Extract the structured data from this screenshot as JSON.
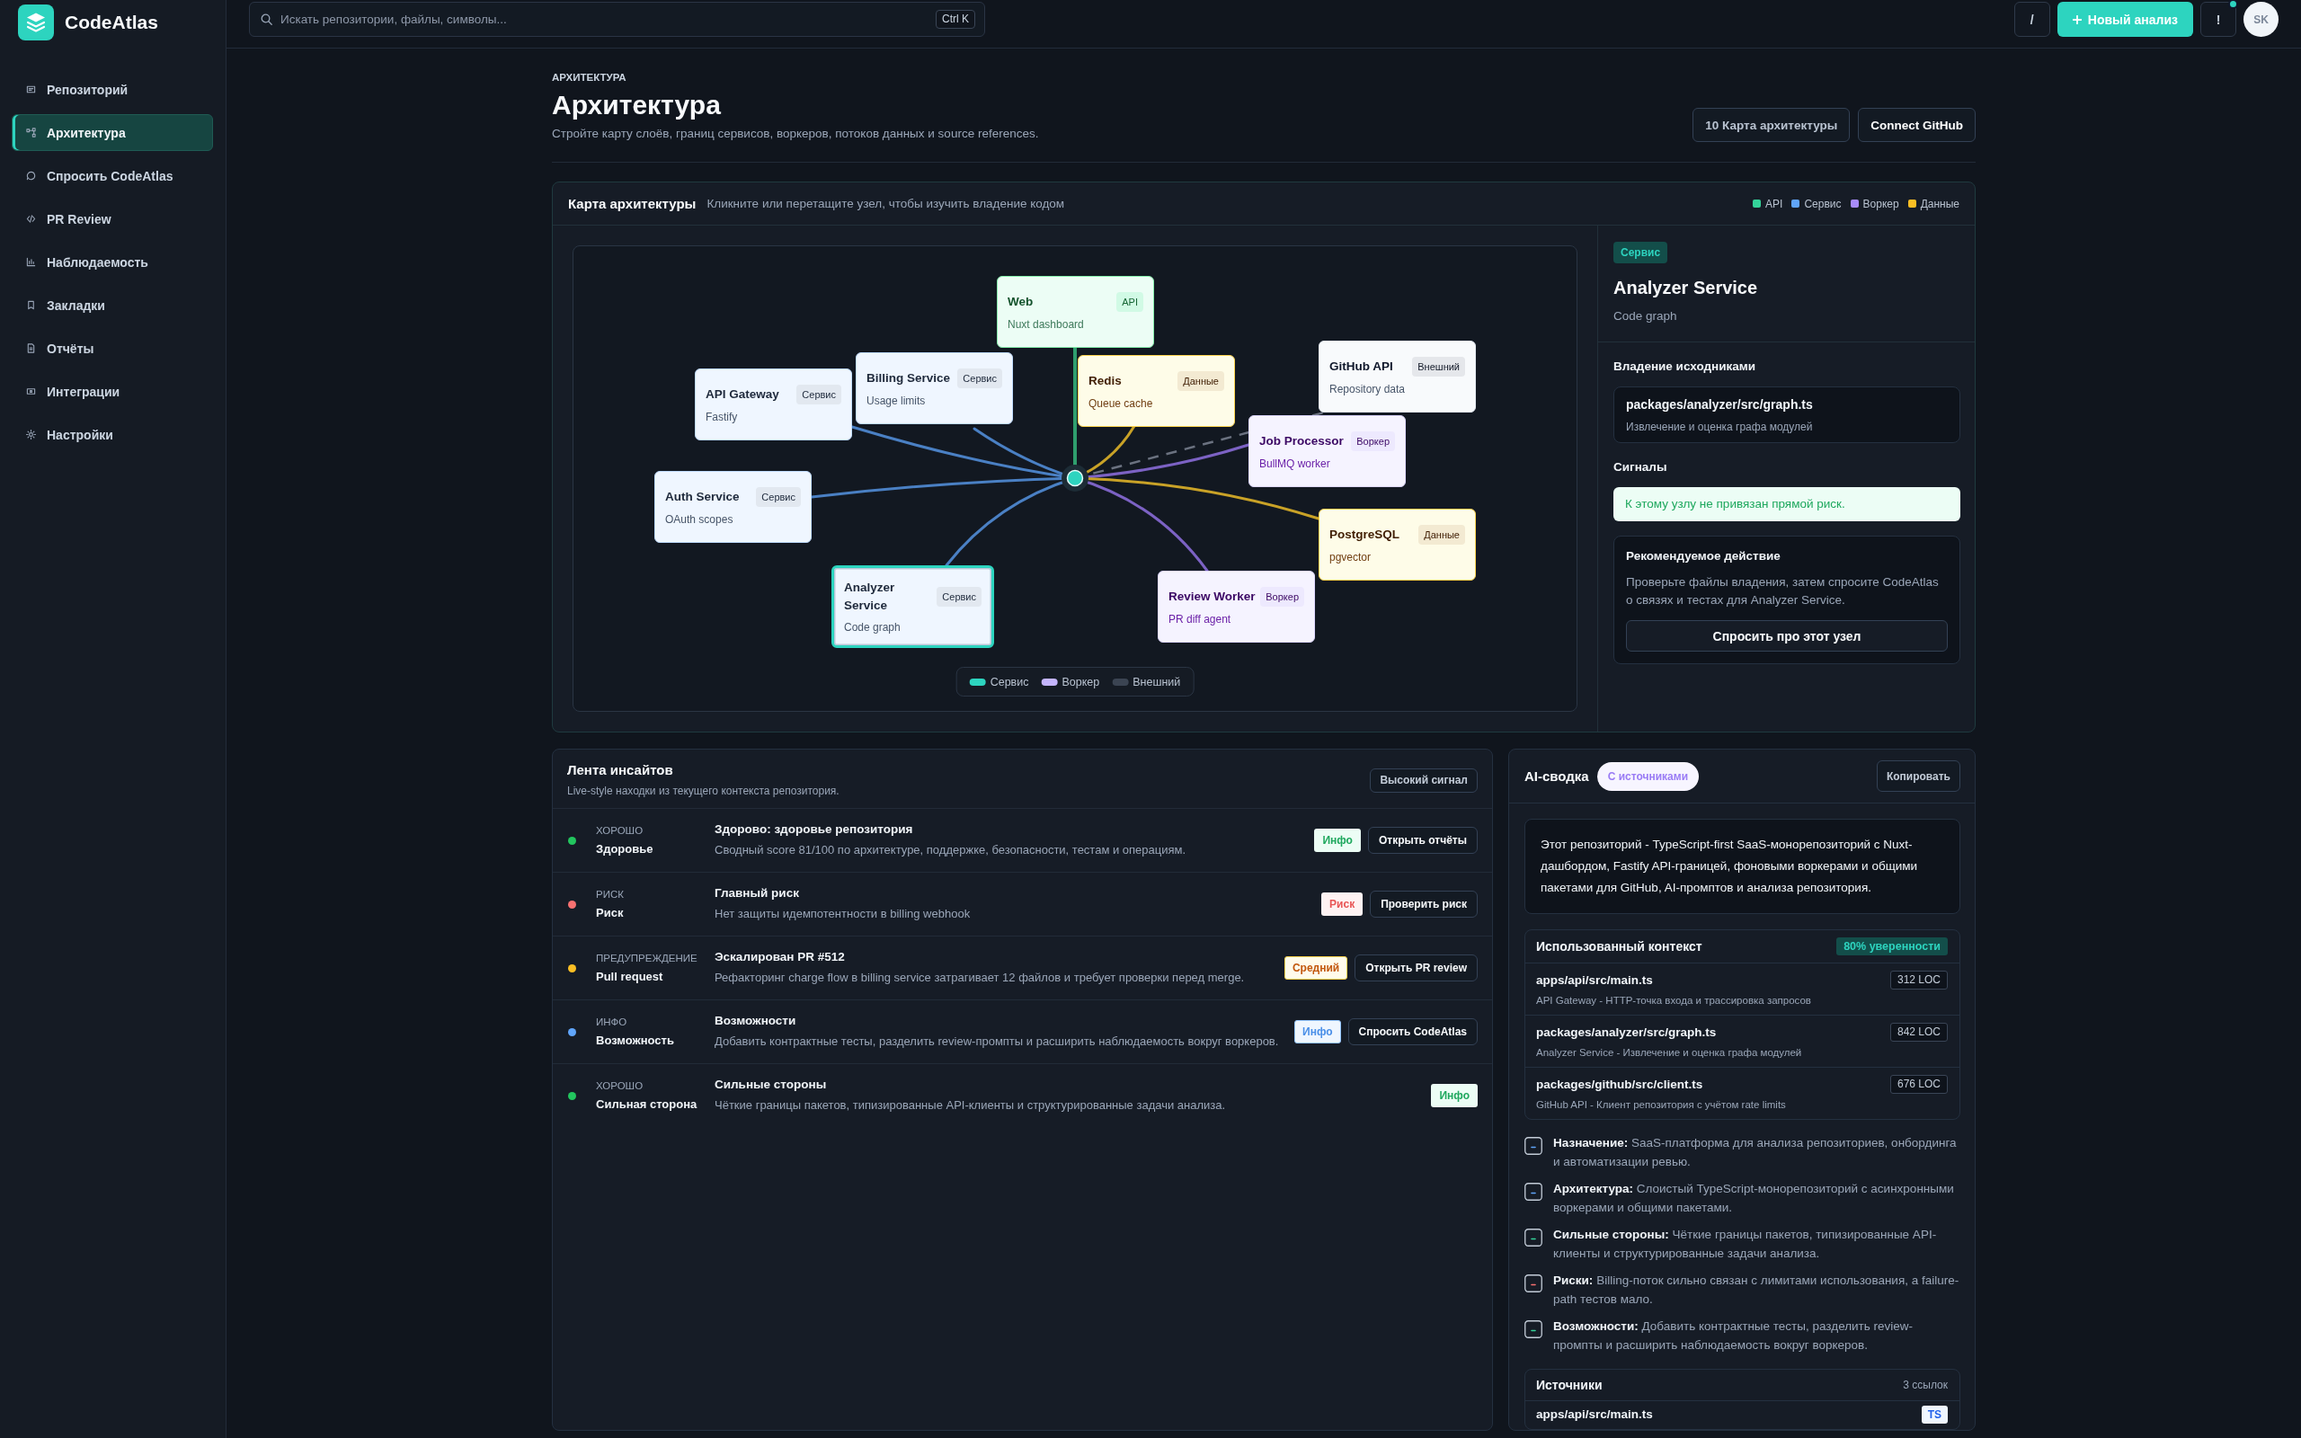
{
  "sidebar": {
    "brand": "CodeAtlas",
    "items": [
      {
        "label": "Репозиторий",
        "selected": false
      },
      {
        "label": "Архитектура",
        "selected": true
      },
      {
        "label": "Спросить CodeAtlas",
        "selected": false
      },
      {
        "label": "PR Review",
        "selected": false
      },
      {
        "label": "Наблюдаемость",
        "selected": false
      },
      {
        "label": "Закладки",
        "selected": false
      },
      {
        "label": "Отчёты",
        "selected": false
      },
      {
        "label": "Интеграции",
        "selected": false
      },
      {
        "label": "Настройки",
        "selected": false
      }
    ]
  },
  "topbar": {
    "search": {
      "placeholder": "Искать репозитории, файлы, символы...",
      "shortcut": "Ctrl K"
    },
    "actions": [
      {
        "kind": "icon",
        "label": "/",
        "notification": false
      },
      {
        "kind": "primary",
        "label": "Новый анализ",
        "notification": false
      },
      {
        "kind": "icon",
        "label": "!",
        "notification": true
      }
    ],
    "avatar": {
      "initials": "SK"
    }
  },
  "page_header": {
    "eyebrow": "АРХИТЕКТУРА",
    "title": "Архитектура",
    "subtitle": "Стройте карту слоёв, границ сервисов, воркеров, потоков данных и source references.",
    "actions": [
      {
        "kind": "secondary",
        "label": "10 Карта архитектуры"
      },
      {
        "kind": "outline",
        "label": "Connect GitHub"
      }
    ]
  },
  "architecture_map": {
    "title": "Карта архитектуры",
    "hint": "Кликните или перетащите узел, чтобы изучить владение кодом",
    "legend": [
      {
        "label": "API",
        "color": "#34d399"
      },
      {
        "label": "Сервис",
        "color": "#60a5fa"
      },
      {
        "label": "Воркер",
        "color": "#a78bfa"
      },
      {
        "label": "Данные",
        "color": "#fbbf24"
      }
    ],
    "nodes": [
      {
        "title": "Web",
        "subtitle": "Nuxt dashboard",
        "badge": "API",
        "kind": "api",
        "selected": false
      },
      {
        "title": "API Gateway",
        "subtitle": "Fastify",
        "badge": "Сервис",
        "kind": "service",
        "selected": false
      },
      {
        "title": "Billing Service",
        "subtitle": "Usage limits",
        "badge": "Сервис",
        "kind": "service",
        "selected": false
      },
      {
        "title": "Redis",
        "subtitle": "Queue cache",
        "badge": "Данные",
        "kind": "data",
        "selected": false
      },
      {
        "title": "GitHub API",
        "subtitle": "Repository data",
        "badge": "Внешний",
        "kind": "external",
        "selected": false
      },
      {
        "title": "Job Processor",
        "subtitle": "BullMQ worker",
        "badge": "Воркер",
        "kind": "worker",
        "selected": false
      },
      {
        "title": "Auth Service",
        "subtitle": "OAuth scopes",
        "badge": "Сервис",
        "kind": "service",
        "selected": false
      },
      {
        "title": "PostgreSQL",
        "subtitle": "pgvector",
        "badge": "Данные",
        "kind": "data",
        "selected": false
      },
      {
        "title": "Analyzer Service",
        "subtitle": "Code graph",
        "badge": "Сервис",
        "kind": "service",
        "selected": true
      },
      {
        "title": "Review Worker",
        "subtitle": "PR diff agent",
        "badge": "Воркер",
        "kind": "worker",
        "selected": false
      }
    ],
    "edge_legend": [
      {
        "label": "Сервис",
        "color": "#2dd4bf"
      },
      {
        "label": "Воркер",
        "color": "#c4b5fd"
      },
      {
        "label": "Внешний",
        "color": "#3b4452"
      }
    ],
    "details": {
      "badge": "Сервис",
      "title": "Analyzer Service",
      "subtitle": "Code graph",
      "ownership": {
        "heading": "Владение исходниками",
        "path": "packages/analyzer/src/graph.ts",
        "note": "Извлечение и оценка графа модулей"
      },
      "signals": {
        "heading": "Сигналы",
        "items": [
          {
            "kind": "ok",
            "text": "К этому узлу не привязан прямой риск."
          }
        ]
      },
      "recommendation": {
        "heading": "Рекомендуемое действие",
        "text": "Проверьте файлы владения, затем спросите CodeAtlas о связях и тестах для Analyzer Service.",
        "button": "Спросить про этот узел"
      }
    }
  },
  "insights": {
    "title": "Лента инсайтов",
    "subtitle": "Live-style находки из текущего контекста репозитория.",
    "filter": "Высокий сигнал",
    "rows": [
      {
        "kind": "good",
        "status": "ХОРОШО",
        "category": "Здоровье",
        "title": "Здорово: здоровье репозитория",
        "text": "Сводный score 81/100 по архитектуре, поддержке, безопасности, тестам и операциям.",
        "badge": "Инфо",
        "action": "Открыть отчёты"
      },
      {
        "kind": "risk",
        "status": "РИСК",
        "category": "Риск",
        "title": "Главный риск",
        "text": "Нет защиты идемпотентности в billing webhook",
        "badge": "Риск",
        "action": "Проверить риск"
      },
      {
        "kind": "warning",
        "status": "ПРЕДУПРЕЖДЕНИЕ",
        "category": "Pull request",
        "title": "Эскалирован PR #512",
        "text": "Рефакторинг charge flow в billing service затрагивает 12 файлов и требует проверки перед merge.",
        "badge": "Средний",
        "action": "Открыть PR review"
      },
      {
        "kind": "info",
        "status": "ИНФО",
        "category": "Возможность",
        "title": "Возможности",
        "text": "Добавить контрактные тесты, разделить review-промпты и расширить наблюдаемость вокруг воркеров.",
        "badge": "Инфо",
        "action": "Спросить CodeAtlas"
      },
      {
        "kind": "good",
        "status": "ХОРОШО",
        "category": "Сильная сторона",
        "title": "Сильные стороны",
        "text": "Чёткие границы пакетов, типизированные API-клиенты и структурированные задачи анализа.",
        "badge": "Инфо"
      }
    ]
  },
  "ai_summary": {
    "title": "AI-сводка",
    "tag": "С источниками",
    "copy_button": "Копировать",
    "summary": "Этот репозиторий - TypeScript-first SaaS-монорепозиторий с Nuxt-дашбордом, Fastify API-границей, фоновыми воркерами и общими пакетами для GitHub, AI-промптов и анализа репозитория.",
    "context": {
      "title": "Использованный контекст",
      "confidence": "80% уверенности",
      "files": [
        {
          "path": "apps/api/src/main.ts",
          "loc": "312 LOC",
          "note": "API Gateway - HTTP-точка входа и трассировка запросов"
        },
        {
          "path": "packages/analyzer/src/graph.ts",
          "loc": "842 LOC",
          "note": "Analyzer Service - Извлечение и оценка графа модулей"
        },
        {
          "path": "packages/github/src/client.ts",
          "loc": "676 LOC",
          "note": "GitHub API - Клиент репозитория с учётом rate limits"
        }
      ]
    },
    "points": [
      {
        "kind": "info",
        "text": "**Назначение:** SaaS-платформа для анализа репозиториев, онбординга и автоматизации ревью."
      },
      {
        "kind": "info",
        "text": "**Архитектура:** Слоистый TypeScript-монорепозиторий с асинхронными воркерами и общими пакетами."
      },
      {
        "kind": "good",
        "text": "**Сильные стороны:** Чёткие границы пакетов, типизированные API-клиенты и структурированные задачи анализа."
      },
      {
        "kind": "risk",
        "text": "**Риски:** Billing-поток сильно связан с лимитами использования, а failure-path тестов мало."
      },
      {
        "kind": "good",
        "text": "**Возможности:** Добавить контрактные тесты, разделить review-промпты и расширить наблюдаемость вокруг воркеров."
      }
    ],
    "sources": {
      "title": "Источники",
      "count": "3 ссылок",
      "items": [
        {
          "path": "apps/api/src/main.ts",
          "lang": "TS"
        }
      ]
    }
  }
}
